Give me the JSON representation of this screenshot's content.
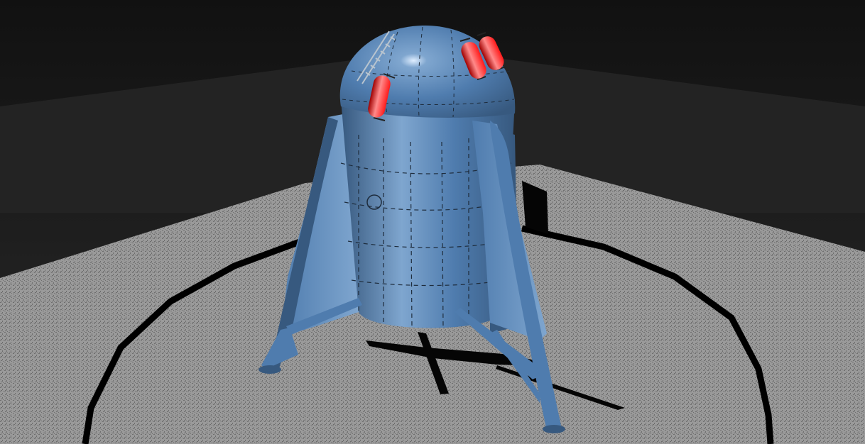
{
  "scene": {
    "subject": "",
    "colors": {
      "sky_top": "#111111",
      "sky_mid": "#2a2a2a",
      "back_wall": "#232323",
      "floor": "#9a9a9a",
      "floor_dark": "#6e6e6e",
      "ring": "#000000",
      "hull": "#4f7cae",
      "hull_dark": "#37597f",
      "hull_light": "#7fa6cf",
      "panel_lines": "#1e2c3c",
      "tanks": "#ff1a1a",
      "tank_highlight": "#ff8a8a",
      "shadow": "#050505"
    }
  }
}
